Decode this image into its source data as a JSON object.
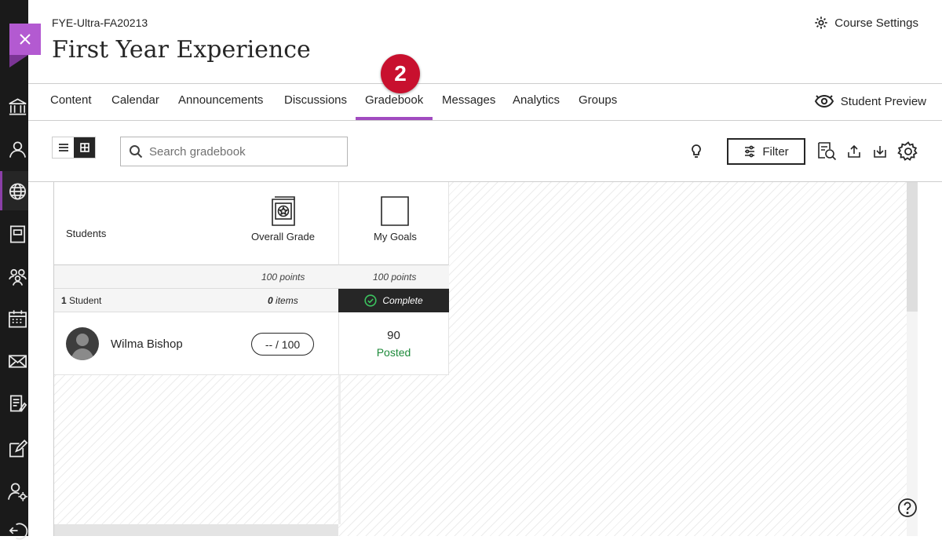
{
  "header": {
    "course_id": "FYE-Ultra-FA20213",
    "course_title": "First Year Experience",
    "course_settings_label": "Course Settings"
  },
  "tabs": [
    {
      "label": "Content"
    },
    {
      "label": "Calendar"
    },
    {
      "label": "Announcements"
    },
    {
      "label": "Discussions"
    },
    {
      "label": "Gradebook",
      "active": true
    },
    {
      "label": "Messages"
    },
    {
      "label": "Analytics"
    },
    {
      "label": "Groups"
    }
  ],
  "step_badge": "2",
  "student_preview_label": "Student Preview",
  "toolbar": {
    "search_placeholder": "Search gradebook",
    "filter_label": "Filter"
  },
  "gradebook": {
    "students_header": "Students",
    "columns": [
      {
        "title": "Overall Grade",
        "points": "100 points",
        "icon": "overall-grade-icon"
      },
      {
        "title": "My Goals",
        "points": "100 points",
        "icon": "document-icon"
      }
    ],
    "student_count": "1",
    "student_count_suffix": " Student",
    "items_count": "0",
    "items_suffix": " items",
    "complete_label": "Complete",
    "rows": [
      {
        "name": "Wilma Bishop",
        "overall_grade": "-- / 100",
        "goal_score": "90",
        "goal_status": "Posted"
      }
    ]
  },
  "colors": {
    "accent": "#a14bc0",
    "badge": "#c8102e",
    "posted": "#1d8a3a",
    "rail": "#1a1a1a"
  },
  "rail_icons": [
    "institution-icon",
    "profile-icon",
    "globe-icon",
    "book-icon",
    "groups-icon",
    "calendar-icon",
    "mail-icon",
    "grades-icon",
    "edit-icon",
    "user-settings-icon",
    "sign-out-icon"
  ]
}
